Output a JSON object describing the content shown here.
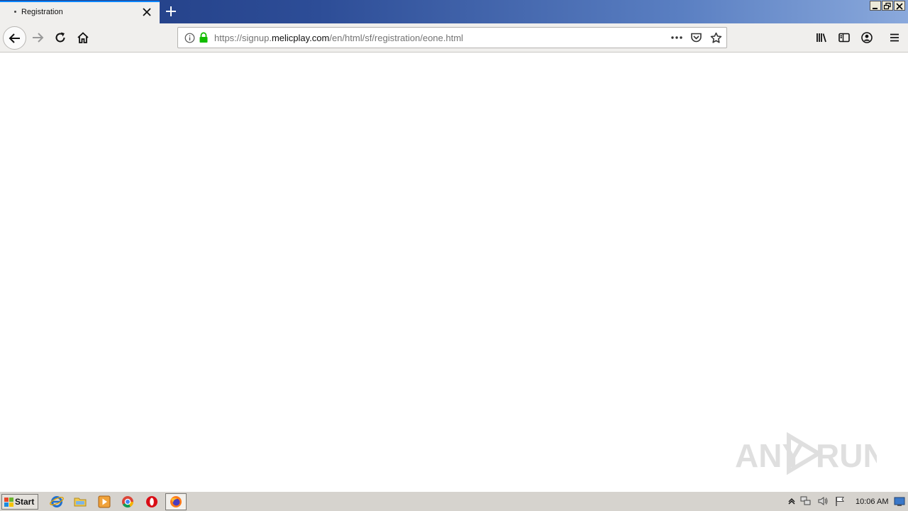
{
  "browser": {
    "tab_title": "Registration",
    "url_prefix": "https://signup.",
    "url_host": "melicplay.com",
    "url_path": "/en/html/sf/registration/eone.html"
  },
  "icons": {
    "back": "back-arrow-icon",
    "forward": "forward-arrow-icon",
    "reload": "reload-icon",
    "home": "home-icon",
    "site_info": "info-icon",
    "secure": "lock-icon",
    "page_actions": "more-actions-icon",
    "pocket": "pocket-icon",
    "bookmark": "star-icon",
    "library": "library-icon",
    "sidebar": "sidebar-icon",
    "account": "account-icon",
    "menu": "hamburger-menu-icon"
  },
  "taskbar": {
    "start_label": "Start",
    "clock": "10:06 AM"
  },
  "watermark": {
    "left": "ANY",
    "right": "RUN"
  },
  "colors": {
    "tab_accent": "#0a84ff",
    "secure_lock": "#12bc00",
    "titlebar_start": "#1f3a80",
    "titlebar_end": "#8aa9dc"
  }
}
